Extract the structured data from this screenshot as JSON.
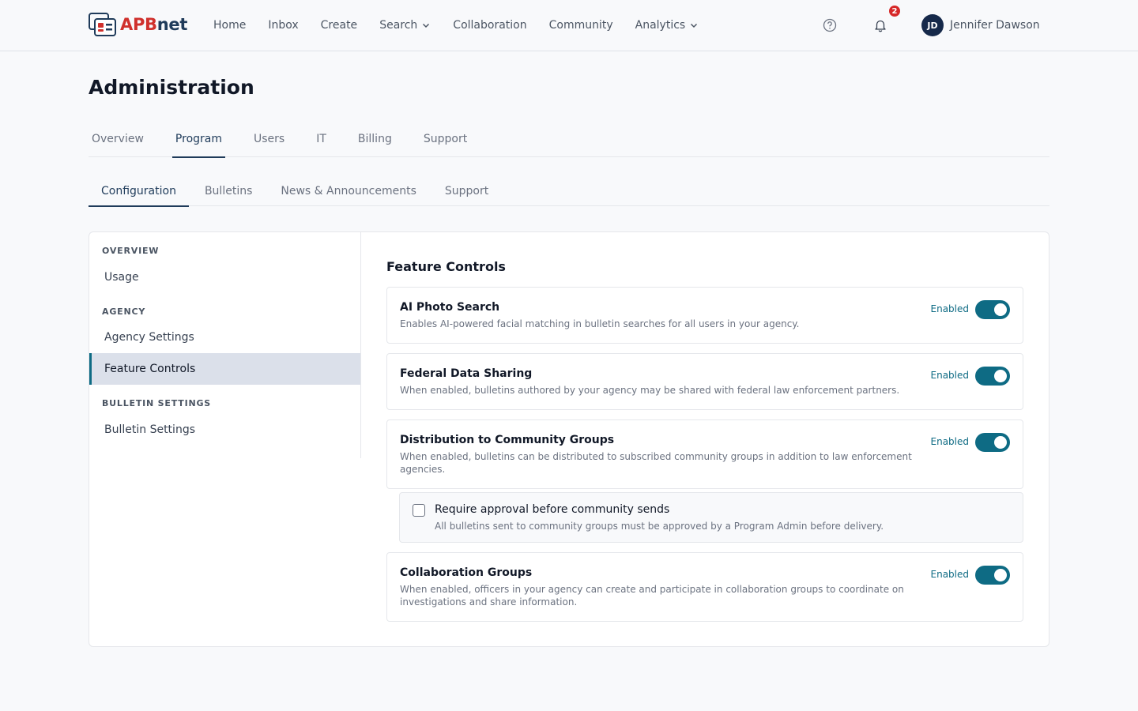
{
  "brand": {
    "apb": "APB",
    "net": "net"
  },
  "nav": {
    "items": [
      "Home",
      "Inbox",
      "Create",
      "Search",
      "Collaboration",
      "Community",
      "Analytics"
    ],
    "notification_count": "2",
    "user_initials": "JD",
    "user_name": "Jennifer Dawson"
  },
  "page": {
    "title": "Administration"
  },
  "primary_tabs": [
    "Overview",
    "Program",
    "Users",
    "IT",
    "Billing",
    "Support"
  ],
  "primary_active": "Program",
  "secondary_tabs": [
    "Configuration",
    "Bulletins",
    "News & Announcements",
    "Support"
  ],
  "secondary_active": "Configuration",
  "sidebar": {
    "sections": [
      {
        "heading": "OVERVIEW",
        "items": [
          "Usage"
        ]
      },
      {
        "heading": "AGENCY",
        "items": [
          "Agency Settings",
          "Feature Controls"
        ]
      },
      {
        "heading": "BULLETIN SETTINGS",
        "items": [
          "Bulletin Settings"
        ]
      }
    ],
    "active_item": "Feature Controls"
  },
  "content": {
    "title": "Feature Controls",
    "features": [
      {
        "title": "AI Photo Search",
        "description": "Enables AI-powered facial matching in bulletin searches for all users in your agency.",
        "status": "Enabled",
        "enabled": true
      },
      {
        "title": "Federal Data Sharing",
        "description": "When enabled, bulletins authored by your agency may be shared with federal law enforcement partners.",
        "status": "Enabled",
        "enabled": true
      },
      {
        "title": "Distribution to Community Groups",
        "description": "When enabled, bulletins can be distributed to subscribed community groups in addition to law enforcement agencies.",
        "status": "Enabled",
        "enabled": true
      },
      {
        "title": "Collaboration Groups",
        "description": "When enabled, officers in your agency can create and participate in collaboration groups to coordinate on investigations and share information.",
        "status": "Enabled",
        "enabled": true
      }
    ],
    "sub_option": {
      "label": "Require approval before community sends",
      "description": "All bulletins sent to community groups must be approved by a Program Admin before delivery.",
      "checked": false
    }
  },
  "colors": {
    "accent": "#0e6b84",
    "brand_red": "#d0312d",
    "brand_navy": "#1f3b5a",
    "badge": "#d62828"
  }
}
